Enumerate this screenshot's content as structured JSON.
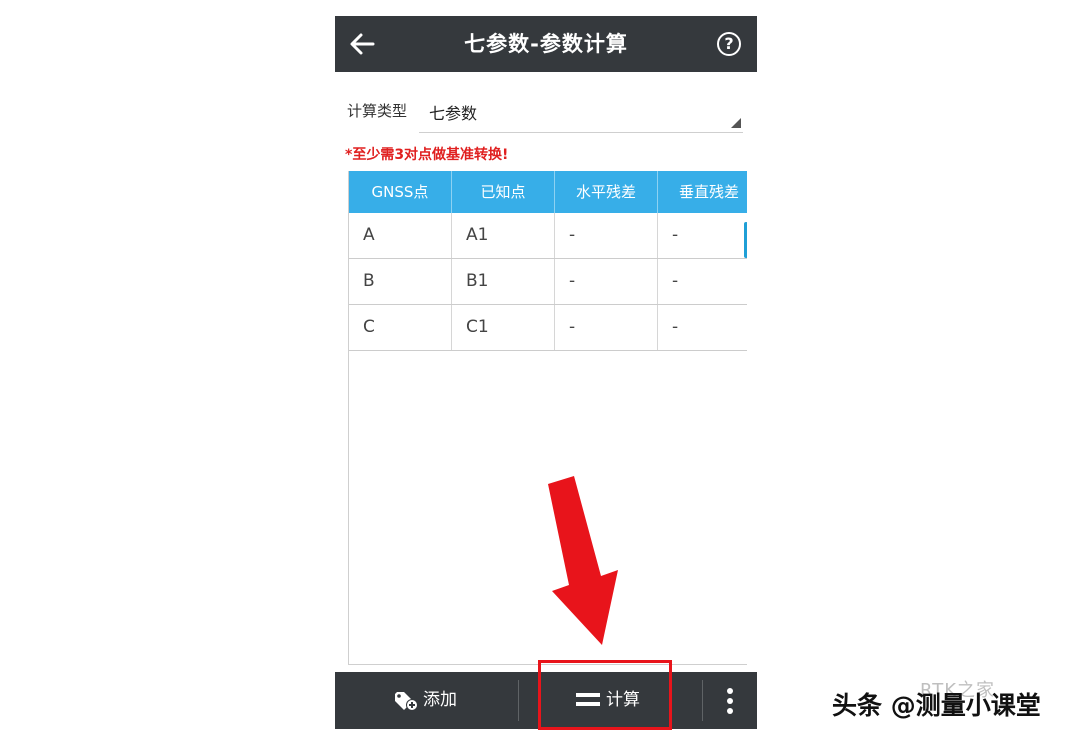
{
  "topbar": {
    "title": "七参数-参数计算",
    "help_symbol": "?"
  },
  "form": {
    "type_label": "计算类型",
    "type_value": "七参数"
  },
  "warning": "*至少需3对点做基准转换!",
  "table": {
    "headers": [
      "GNSS点",
      "已知点",
      "水平残差",
      "垂直残差"
    ],
    "rows": [
      [
        "A",
        "A1",
        "-",
        "-"
      ],
      [
        "B",
        "B1",
        "-",
        "-"
      ],
      [
        "C",
        "C1",
        "-",
        "-"
      ]
    ]
  },
  "bottombar": {
    "add_label": "添加",
    "calc_label": "计算"
  },
  "watermark": {
    "ghost": "RTK之家",
    "text": "头条 @测量小课堂"
  },
  "colors": {
    "bar_bg": "#35393d",
    "header_bg": "#37aee8",
    "warning": "#e02020",
    "annotation_red": "#e8141b"
  },
  "icons": {
    "back": "arrow-left-icon",
    "help": "question-circle-icon",
    "add": "tag-plus-icon",
    "calc": "equals-icon",
    "more": "vertical-dots-icon"
  }
}
